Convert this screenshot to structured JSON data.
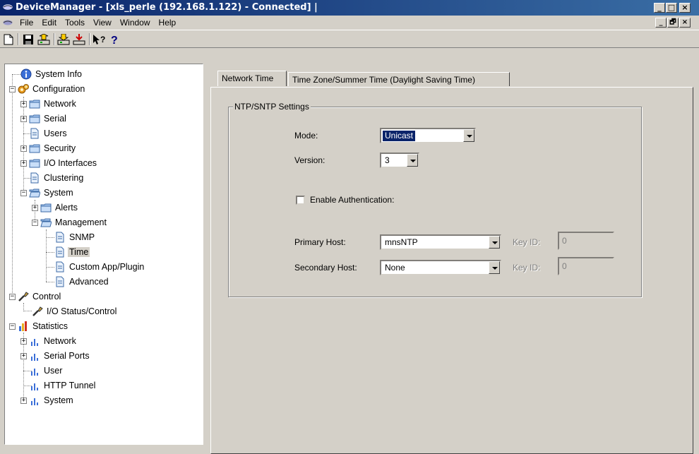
{
  "window": {
    "title": "DeviceManager - [xls_perle (192.168.1.122) - Connected] |",
    "minimize_glyph": "_",
    "maximize_glyph": "□",
    "close_glyph": "×",
    "restore_glyph": "🗗"
  },
  "menubar": {
    "items": [
      "File",
      "Edit",
      "Tools",
      "View",
      "Window",
      "Help"
    ]
  },
  "toolbar": {
    "buttons": [
      "new-icon",
      "save-icon",
      "upload-icon",
      "download-icon",
      "export-icon",
      "whats-this-help-icon",
      "help-icon"
    ]
  },
  "tree": {
    "system_info": "System Info",
    "configuration": "Configuration",
    "network": "Network",
    "serial": "Serial",
    "users": "Users",
    "security": "Security",
    "io_interfaces": "I/O Interfaces",
    "clustering": "Clustering",
    "system": "System",
    "alerts": "Alerts",
    "management": "Management",
    "snmp": "SNMP",
    "time": "Time",
    "custom_app": "Custom App/Plugin",
    "advanced": "Advanced",
    "control": "Control",
    "io_status": "I/O Status/Control",
    "statistics": "Statistics",
    "stat_network": "Network",
    "stat_serial_ports": "Serial Ports",
    "stat_user": "User",
    "stat_http_tunnel": "HTTP Tunnel",
    "stat_system": "System"
  },
  "tabs": {
    "network_time": "Network Time",
    "time_zone": "Time Zone/Summer Time (Daylight Saving Time)"
  },
  "ntp": {
    "group_title": "NTP/SNTP Settings",
    "mode_label": "Mode:",
    "mode_value": "Unicast",
    "version_label": "Version:",
    "version_value": "3",
    "enable_auth_label": "Enable Authentication:",
    "enable_auth_checked": false,
    "primary_host_label": "Primary Host:",
    "primary_host_value": "mnsNTP",
    "primary_key_label": "Key ID:",
    "primary_key_value": "0",
    "secondary_host_label": "Secondary Host:",
    "secondary_host_value": "None",
    "secondary_key_label": "Key ID:",
    "secondary_key_value": "0"
  },
  "colors": {
    "titlebar_start": "#0a246a",
    "titlebar_end": "#3a6ea5",
    "selection": "#0a246a",
    "face": "#d4d0c8"
  }
}
